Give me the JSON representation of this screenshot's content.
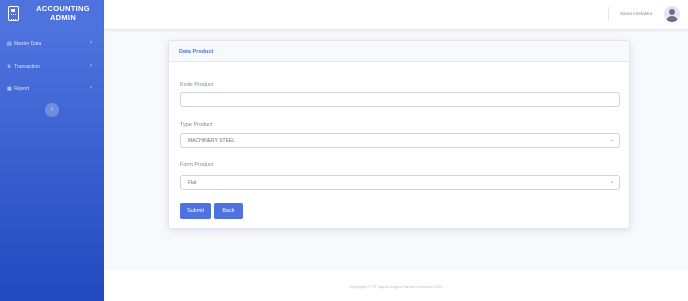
{
  "sidebar": {
    "brand": "ACCOUNTING ADMIN",
    "items": [
      {
        "label": "Master Data",
        "icon": "database-icon"
      },
      {
        "label": "Transaction",
        "icon": "transfer-icon"
      },
      {
        "label": "Report",
        "icon": "table-icon"
      }
    ],
    "toggle_glyph": "‹"
  },
  "topbar": {
    "user_name": "Sama Artefaktur"
  },
  "card": {
    "title": "Data Product",
    "fields": [
      {
        "label": "Kode Product",
        "value": "",
        "type": "text"
      },
      {
        "label": "Type Product",
        "value": "MACHINERY STEEL",
        "type": "select"
      },
      {
        "label": "Form Product",
        "value": "Flat",
        "type": "select"
      }
    ],
    "submit_label": "Submit",
    "back_label": "Back"
  },
  "footer": {
    "text": "Copyright © PT Inaplo Kagos Hanon Indonesia 2021"
  },
  "colors": {
    "primary": "#4e73df",
    "sidebar_end": "#224abe",
    "background": "#f8f9fc"
  }
}
